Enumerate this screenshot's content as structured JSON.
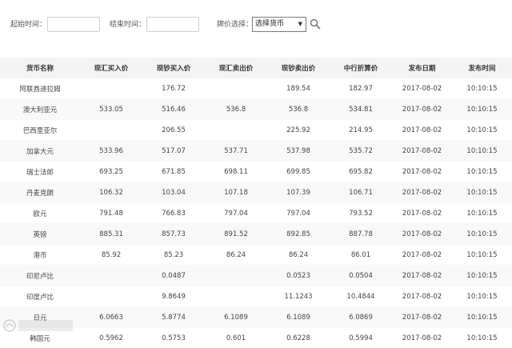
{
  "filters": {
    "start_label": "起始时间：",
    "start_value": "",
    "end_label": "结束时间：",
    "end_value": "",
    "currency_label": "牌价选择：",
    "currency_selected": "选择货币"
  },
  "table": {
    "headers": [
      "货币名称",
      "现汇买入价",
      "现钞买入价",
      "现汇卖出价",
      "现钞卖出价",
      "中行折算价",
      "发布日期",
      "发布时间"
    ],
    "rows": [
      [
        "阿联酋迪拉姆",
        "",
        "176.72",
        "",
        "189.54",
        "182.97",
        "2017-08-02",
        "10:10:15"
      ],
      [
        "澳大利亚元",
        "533.05",
        "516.46",
        "536.8",
        "536.8",
        "534.81",
        "2017-08-02",
        "10:10:15"
      ],
      [
        "巴西里亚尔",
        "",
        "206.55",
        "",
        "225.92",
        "214.95",
        "2017-08-02",
        "10:10:15"
      ],
      [
        "加拿大元",
        "533.96",
        "517.07",
        "537.71",
        "537.98",
        "535.72",
        "2017-08-02",
        "10:10:15"
      ],
      [
        "瑞士法郎",
        "693.25",
        "671.85",
        "698.11",
        "699.85",
        "695.82",
        "2017-08-02",
        "10:10:15"
      ],
      [
        "丹麦克朗",
        "106.32",
        "103.04",
        "107.18",
        "107.39",
        "106.71",
        "2017-08-02",
        "10:10:15"
      ],
      [
        "欧元",
        "791.48",
        "766.83",
        "797.04",
        "797.04",
        "793.52",
        "2017-08-02",
        "10:10:15"
      ],
      [
        "英镑",
        "885.31",
        "857.73",
        "891.52",
        "892.85",
        "887.78",
        "2017-08-02",
        "10:10:15"
      ],
      [
        "港币",
        "85.92",
        "85.23",
        "86.24",
        "86.24",
        "86.01",
        "2017-08-02",
        "10:10:15"
      ],
      [
        "印尼卢比",
        "",
        "0.0487",
        "",
        "0.0523",
        "0.0504",
        "2017-08-02",
        "10:10:15"
      ],
      [
        "印度卢比",
        "",
        "9.8649",
        "",
        "11.1243",
        "10.4844",
        "2017-08-02",
        "10:10:15"
      ],
      [
        "日元",
        "6.0663",
        "5.8774",
        "6.1089",
        "6.1089",
        "6.0869",
        "2017-08-02",
        "10:10:15"
      ],
      [
        "韩国元",
        "0.5962",
        "0.5753",
        "0.601",
        "0.6228",
        "0.5994",
        "2017-08-02",
        "10:10:15"
      ]
    ]
  },
  "icons": {
    "search": "search-icon",
    "dropdown": "chevron-down-icon"
  }
}
